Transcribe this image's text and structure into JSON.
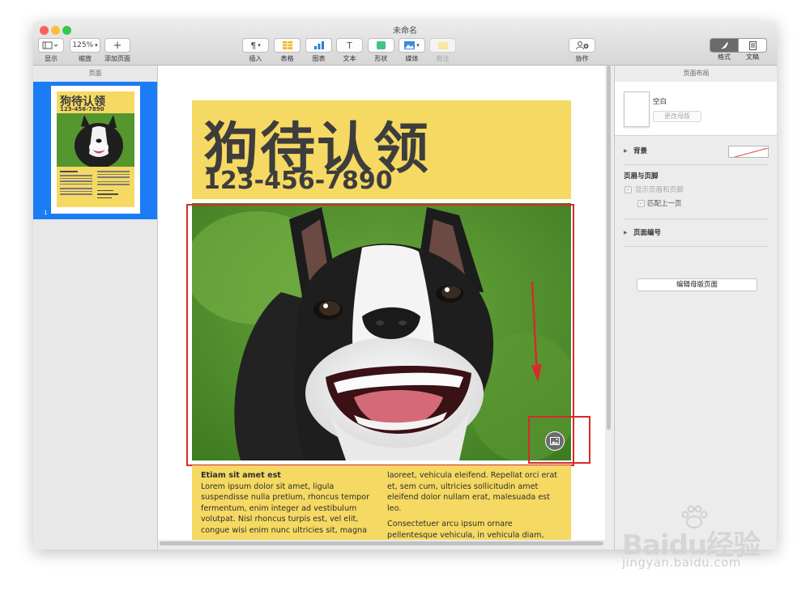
{
  "window": {
    "title": "未命名"
  },
  "toolbar": {
    "view_label": "显示",
    "zoom_value": "125%",
    "zoom_label": "缩放",
    "add_page_label": "添加页面",
    "insert_label": "插入",
    "table_label": "表格",
    "chart_label": "图表",
    "text_label": "文本",
    "shape_label": "形状",
    "media_label": "媒体",
    "comment_label": "批注",
    "collaborate_label": "协作",
    "format_label": "格式",
    "document_label": "文稿"
  },
  "sidebar": {
    "title": "页面",
    "page_number": "1"
  },
  "thumbnail": {
    "title": "狗待认领",
    "phone": "123-456-7890"
  },
  "flyer": {
    "title": "狗待认领",
    "phone": "123-456-7890",
    "col1_heading": "Etiam sit amet est",
    "col1_body": "Lorem ipsum dolor sit amet, ligula suspendisse nulla pretium, rhoncus tempor fermentum, enim integer ad vestibulum volutpat. Nisl rhoncus turpis est, vel elit, congue wisi enim nunc ultricies sit, magna",
    "col2_para1": "laoreet, vehicula eleifend. Repellat orci erat et, sem cum, ultricies sollicitudin amet eleifend dolor nullam erat, malesuada est leo.",
    "col2_para2": "Consectetuer arcu ipsum ornare pellentesque vehicula, in vehicula diam, ornare magna erat felis wisi a risus. Justo fermentum id"
  },
  "inspector": {
    "title": "页面布局",
    "master_name": "空白",
    "change_master": "更改母版",
    "background_label": "背景",
    "header_footer_label": "页眉与页脚",
    "show_header_footer": "显示页眉和页脚",
    "match_previous": "匹配上一页",
    "page_numbering": "页面编号",
    "edit_master": "编辑母版页面"
  },
  "watermark": {
    "brand": "Baidu经验",
    "url": "jingyan.baidu.com"
  },
  "colors": {
    "flyer_yellow": "#f5d962",
    "selection_blue": "#1b7cf5",
    "annotation_red": "#d62b2b"
  },
  "icons": [
    "view-icon",
    "add-icon",
    "insert-icon",
    "table-icon",
    "chart-icon",
    "text-icon",
    "shape-icon",
    "media-icon",
    "comment-icon",
    "collaborate-icon",
    "format-icon",
    "document-icon",
    "image-placeholder-icon"
  ]
}
